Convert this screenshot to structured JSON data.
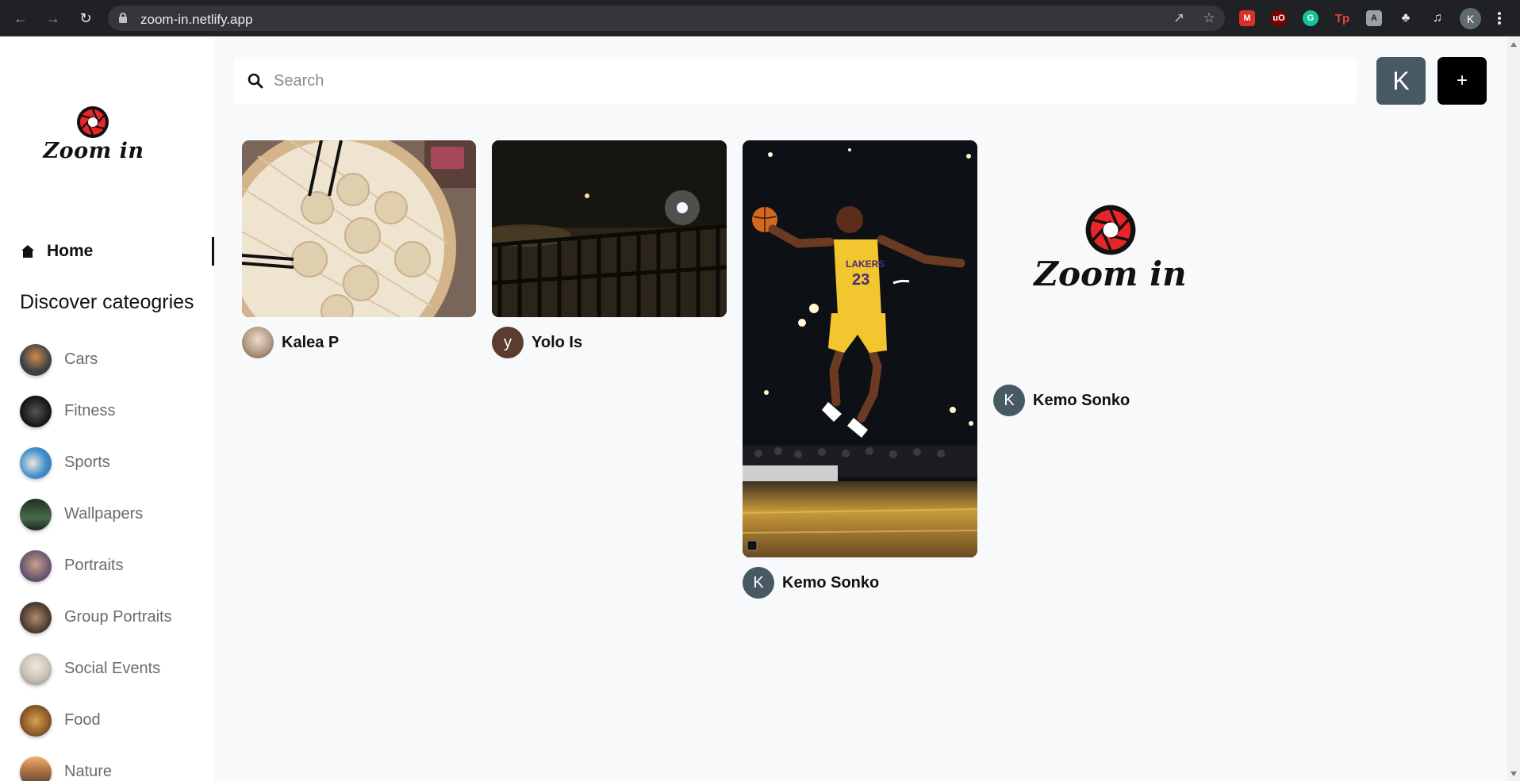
{
  "browser": {
    "url": "zoom-in.netlify.app",
    "profile_initial": "K",
    "extensions": [
      "gmail-icon",
      "ublock-icon",
      "grammarly-icon",
      "tp-icon",
      "translate-icon",
      "puzzle-icon",
      "media-icon"
    ]
  },
  "sidebar": {
    "logo_text": "Zoom in",
    "home_label": "Home",
    "discover_title": "Discover cateogries",
    "categories": [
      {
        "label": "Cars",
        "thumb": "#3a4047"
      },
      {
        "label": "Fitness",
        "thumb": "#1e1e1e"
      },
      {
        "label": "Sports",
        "thumb": "#3f8fd0"
      },
      {
        "label": "Wallpapers",
        "thumb": "#2f4a33"
      },
      {
        "label": "Portraits",
        "thumb": "#6b5870"
      },
      {
        "label": "Group Portraits",
        "thumb": "#4a3a30"
      },
      {
        "label": "Social Events",
        "thumb": "#c9c2b4"
      },
      {
        "label": "Food",
        "thumb": "#8a5a2a"
      },
      {
        "label": "Nature",
        "thumb": "#b07040"
      }
    ]
  },
  "header": {
    "search_placeholder": "Search",
    "user_initial": "K",
    "add_label": "+"
  },
  "pins": [
    {
      "author": "Kalea P",
      "avatar_initial": "",
      "avatar_color": "#8a7a6a",
      "image": "soup-dumplings-photo"
    },
    {
      "author": "Yolo Is",
      "avatar_initial": "y",
      "avatar_color": "#5b3b32",
      "image": "night-street-photo"
    },
    {
      "author": "Kemo Sonko",
      "avatar_initial": "K",
      "avatar_color": "#475963",
      "image": "basketball-dunk-photo"
    },
    {
      "author": "Kemo Sonko",
      "avatar_initial": "K",
      "avatar_color": "#475963",
      "image": "zoom-in-logo",
      "logo_text": "Zoom in"
    }
  ],
  "colors": {
    "accent": "#e8262a",
    "sidebar_bg": "#ffffff",
    "page_bg": "#f8f9fb",
    "avatar_btn": "#475963",
    "add_btn": "#000000"
  }
}
